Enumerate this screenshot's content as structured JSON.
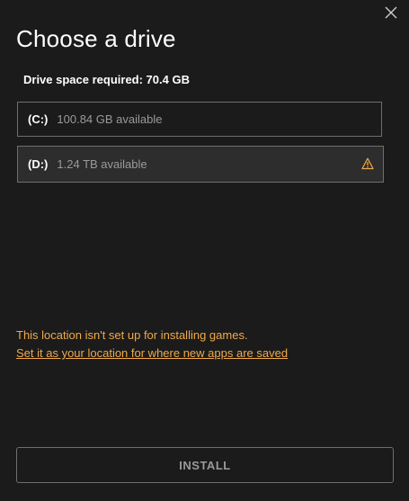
{
  "dialog": {
    "title": "Choose a drive",
    "space_required": "Drive space required: 70.4 GB",
    "close_icon": "close-icon"
  },
  "drives": [
    {
      "letter": "(C:)",
      "available": "100.84 GB available",
      "selected": false,
      "warning": false
    },
    {
      "letter": "(D:)",
      "available": "1.24 TB available",
      "selected": true,
      "warning": true,
      "warning_icon": "warning-triangle-icon"
    }
  ],
  "warning": {
    "message": "This location isn't set up for installing games.",
    "link": "Set it as your location for where new apps are saved",
    "color": "#f0a94b"
  },
  "actions": {
    "install_label": "INSTALL"
  }
}
